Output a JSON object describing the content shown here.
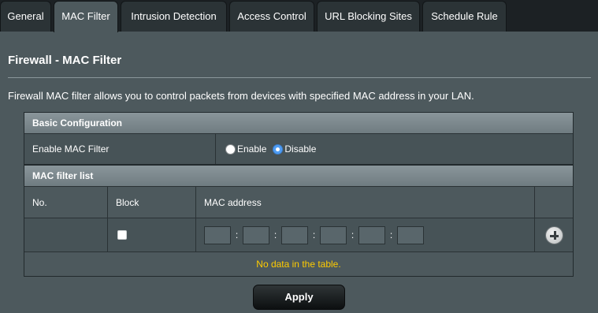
{
  "tabs": [
    {
      "label": "General"
    },
    {
      "label": "MAC Filter"
    },
    {
      "label": "Intrusion Detection"
    },
    {
      "label": "Access Control"
    },
    {
      "label": "URL Blocking Sites"
    },
    {
      "label": "Schedule Rule"
    }
  ],
  "active_tab": "MAC Filter",
  "page": {
    "title": "Firewall - MAC Filter",
    "description": "Firewall MAC filter allows you to control packets from devices with specified MAC address in your LAN."
  },
  "basic_config": {
    "header": "Basic Configuration",
    "enable_label": "Enable MAC Filter",
    "option_enable": "Enable",
    "option_disable": "Disable",
    "selected": "Disable"
  },
  "filter_list": {
    "header": "MAC filter list",
    "columns": {
      "no": "No.",
      "block": "Block",
      "mac": "MAC address"
    },
    "empty_message": "No data in the table.",
    "mac_separator": ":",
    "mac_octets": [
      "",
      "",
      "",
      "",
      "",
      ""
    ],
    "block_checked": false
  },
  "buttons": {
    "apply": "Apply"
  },
  "colors": {
    "background": "#4d595d",
    "tab_bar": "#1c2124",
    "section_header": "#7d898e",
    "empty_message": "#ffcc00",
    "radio_selected": "#4f9df4"
  }
}
